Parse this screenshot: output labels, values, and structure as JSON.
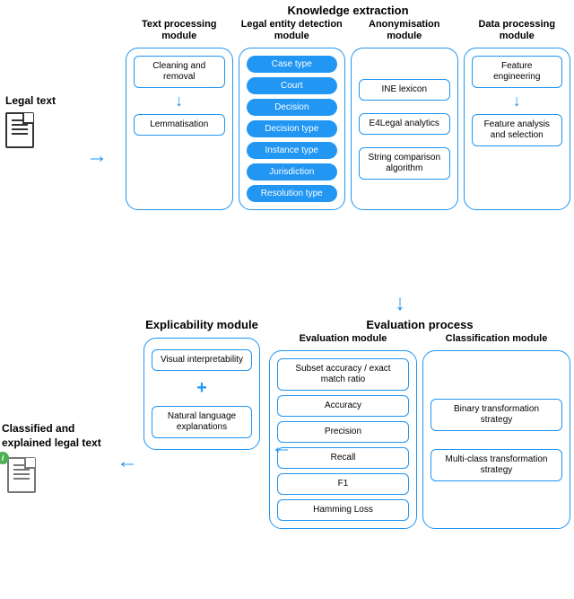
{
  "input_label": "Legal text",
  "knowledge_extraction": {
    "title": "Knowledge extraction",
    "text_processing": {
      "title": "Text processing module",
      "step1": "Cleaning and removal",
      "step2": "Lemmatisation"
    },
    "legal_entity": {
      "title": "Legal entity detection module",
      "tags": {
        "t0": "Case type",
        "t1": "Court",
        "t2": "Decision",
        "t3": "Decision type",
        "t4": "Instance type",
        "t5": "Jurisdiction",
        "t6": "Resolution type"
      }
    },
    "anonymisation": {
      "title": "Anonymisation module",
      "i0": "INE lexicon",
      "i1": "E4Legal analytics",
      "i2": "String comparison algorithm"
    },
    "data_processing": {
      "title": "Data processing module",
      "s1": "Feature engineering",
      "s2": "Feature analysis and selection"
    }
  },
  "evaluation_process": {
    "title": "Evaluation process",
    "evaluation": {
      "title": "Evaluation module",
      "m0": "Subset accuracy / exact match ratio",
      "m1": "Accuracy",
      "m2": "Precision",
      "m3": "Recall",
      "m4": "F1",
      "m5": "Hamming Loss"
    },
    "classification": {
      "title": "Classification module",
      "s0": "Binary transformation strategy",
      "s1": "Multi-class transformation strategy"
    }
  },
  "explicability": {
    "title": "Explicability module",
    "i0": "Visual interpretability",
    "i1": "Natural language explanations"
  },
  "output_label": "Classified and explained legal text",
  "badge_char": "i"
}
